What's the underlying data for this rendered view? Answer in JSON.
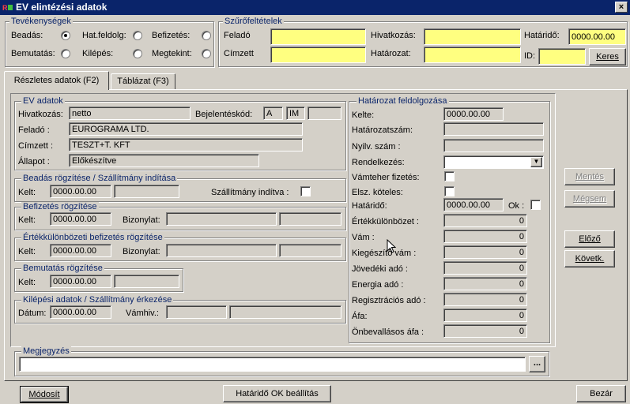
{
  "window": {
    "title": "EV elintézési adatok",
    "close_glyph": "×"
  },
  "activity": {
    "title": "Tevékenységek",
    "options": [
      {
        "label": "Beadás:",
        "checked": true
      },
      {
        "label": "Hat.feldolg:",
        "checked": false
      },
      {
        "label": "Befizetés:",
        "checked": false
      },
      {
        "label": "Bemutatás:",
        "checked": false
      },
      {
        "label": "Kilépés:",
        "checked": false
      },
      {
        "label": "Megtekint:",
        "checked": false
      }
    ]
  },
  "filter": {
    "title": "Szűrőfeltételek",
    "felado_label": "Feladó",
    "felado_value": "",
    "hivatkozas_label": "Hivatkozás:",
    "hivatkozas_value": "",
    "hatarido_label": "Határidő:",
    "hatarido_value": "0000.00.00",
    "cimzett_label": "Címzett",
    "cimzett_value": "",
    "hatarozat_label": "Határozat:",
    "hatarozat_value": "",
    "id_label": "ID:",
    "id_value": "",
    "search_button": "Keres"
  },
  "tabs": [
    {
      "label": "Részletes adatok (F2)",
      "active": true
    },
    {
      "label": "Táblázat (F3)",
      "active": false
    }
  ],
  "ev": {
    "title": "EV adatok",
    "hivatkozas_label": "Hivatkozás:",
    "hivatkozas_value": "netto",
    "bejelentes_label": "Bejelentéskód:",
    "bejelentes_a": "A",
    "bejelentes_im": "IM",
    "bejelentes_3": "",
    "felado_label": "Feladó :",
    "felado_value": "EUROGRAMA LTD.",
    "cimzett_label": "Címzett :",
    "cimzett_value": "TESZT+T. KFT",
    "allapot_label": "Állapot :",
    "allapot_value": "Előkészítve"
  },
  "beadas": {
    "title": "Beadás rögzítése / Szállítmány indítása",
    "kelt_label": "Kelt:",
    "kelt_value": "0000.00.00",
    "extra_value": "",
    "szallitmany_label": "Szállítmány indítva :"
  },
  "befizetes": {
    "title": "Befizetés rögzítése",
    "kelt_label": "Kelt:",
    "kelt_value": "0000.00.00",
    "bizonylat_label": "Bizonylat:",
    "bizonylat_value": "",
    "extra_value": ""
  },
  "ertekkulonbozeti": {
    "title": "Értékkülönbözeti befizetés rögzítése",
    "kelt_label": "Kelt:",
    "kelt_value": "0000.00.00",
    "bizonylat_label": "Bizonylat:",
    "bizonylat_value": "",
    "extra_value": ""
  },
  "bemutatas": {
    "title": "Bemutatás rögzítése",
    "kelt_label": "Kelt:",
    "kelt_value": "0000.00.00",
    "extra_value": ""
  },
  "kilepesi": {
    "title": "Kilépési adatok / Szállítmány érkezése",
    "datum_label": "Dátum:",
    "datum_value": "0000.00.00",
    "vamhiv_label": "Vámhiv.:",
    "vamhiv_value": "",
    "extra_value": ""
  },
  "hatarozat": {
    "title": "Határozat feldolgozása",
    "kelte_label": "Kelte:",
    "kelte_value": "0000.00.00",
    "hatarozatszam_label": "Határozatszám:",
    "hatarozatszam_value": "",
    "nyilv_label": "Nyilv. szám :",
    "nyilv_value": "",
    "rendelkezes_label": "Rendelkezés:",
    "rendelkezes_value": "",
    "vamteher_label": "Vámteher fizetés:",
    "elsz_label": "Elsz. köteles:",
    "hatarido_label": "Határidő:",
    "hatarido_value": "0000.00.00",
    "ok_label": "Ok :",
    "amounts": [
      {
        "label": "Értékkülönbözet :",
        "value": "0"
      },
      {
        "label": "Vám :",
        "value": "0"
      },
      {
        "label": "Kiegészítő vám :",
        "value": "0"
      },
      {
        "label": "Jövedéki adó :",
        "value": "0"
      },
      {
        "label": "Energia adó :",
        "value": "0"
      },
      {
        "label": "Regisztrációs adó :",
        "value": "0"
      },
      {
        "label": "Áfa:",
        "value": "0"
      },
      {
        "label": "Önbevallásos áfa :",
        "value": "0"
      }
    ]
  },
  "side_buttons": {
    "mentes": "Mentés",
    "megsem": "Mégsem",
    "elozo": "Előző",
    "kovetk": "Követk."
  },
  "megjegyzes": {
    "title": "Megjegyzés",
    "value": "",
    "dots": "..."
  },
  "bottom": {
    "modosit": "Módosít",
    "hatarido_ok": "Határidő OK beállítás",
    "bezar": "Bezár"
  }
}
